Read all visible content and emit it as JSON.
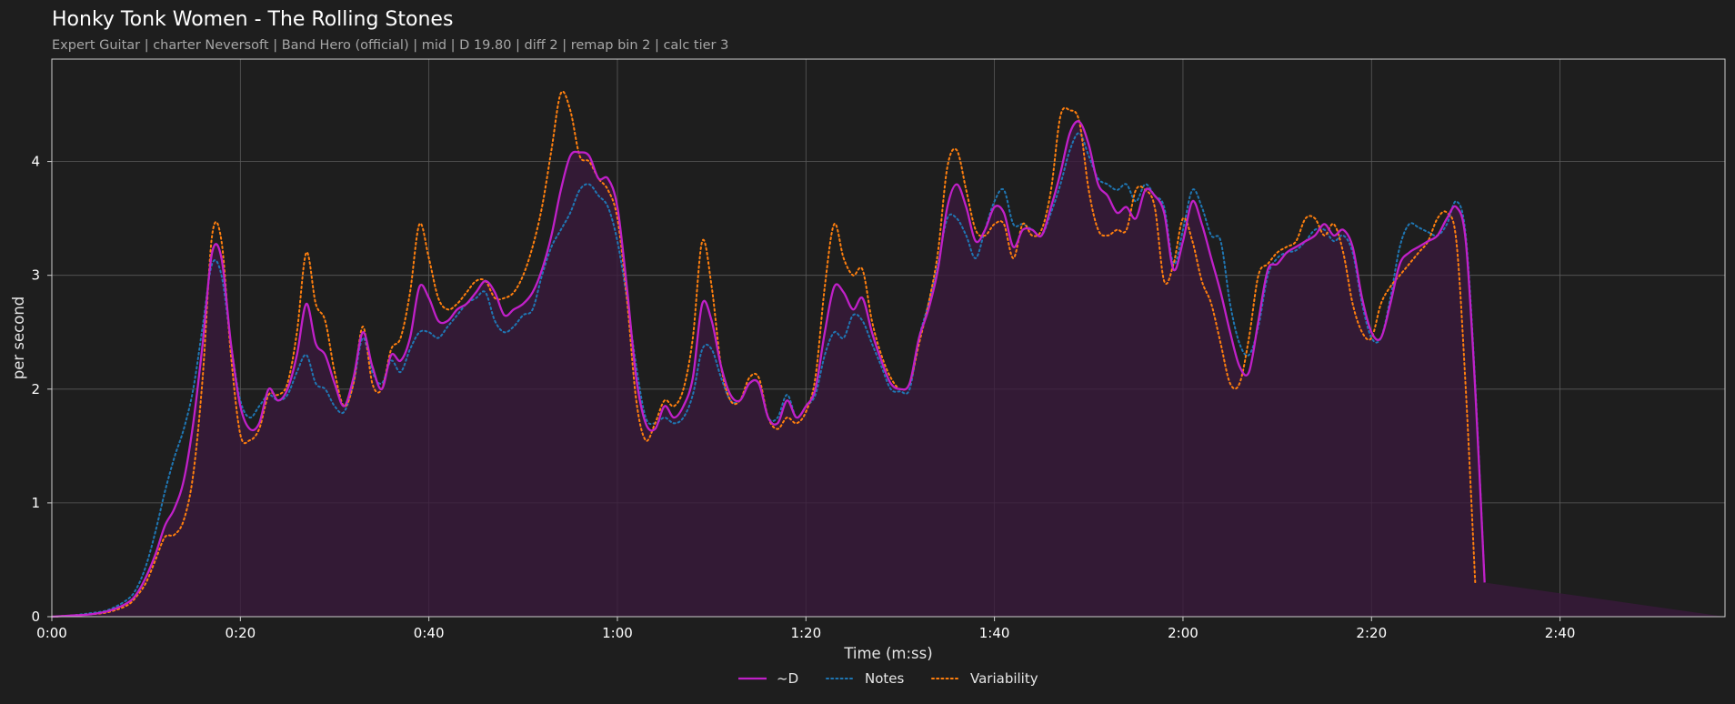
{
  "chart_data": {
    "type": "line",
    "title": "Honky Tonk Women - The Rolling Stones",
    "subtitle": "Expert Guitar  |  charter Neversoft  |  Band Hero (official)  |  mid  |  D 19.80  |  diff 2  |  remap bin 2  |  calc tier 3",
    "xlabel": "Time (m:ss)",
    "ylabel": "per second",
    "xlim": [
      0,
      177.5
    ],
    "ylim": [
      0,
      4.9
    ],
    "x_ticks": [
      0,
      20,
      40,
      60,
      80,
      100,
      120,
      140,
      160
    ],
    "x_tick_labels": [
      "0:00",
      "0:20",
      "0:40",
      "1:00",
      "1:20",
      "1:40",
      "2:00",
      "2:20",
      "2:40"
    ],
    "y_ticks": [
      0,
      1,
      2,
      3,
      4
    ],
    "y_tick_labels": [
      "0",
      "1",
      "2",
      "3",
      "4"
    ],
    "grid": true,
    "legend_position": "bottom-center",
    "x": [
      0,
      2,
      4,
      6,
      8,
      9,
      10,
      11,
      12,
      13,
      14,
      15,
      16,
      17,
      18,
      19,
      20,
      21,
      22,
      23,
      24,
      25,
      26,
      27,
      28,
      29,
      30,
      31,
      32,
      33,
      34,
      35,
      36,
      37,
      38,
      39,
      40,
      41,
      42,
      43,
      44,
      45,
      46,
      47,
      48,
      49,
      50,
      51,
      52,
      53,
      54,
      55,
      56,
      57,
      58,
      59,
      60,
      61,
      62,
      63,
      64,
      65,
      66,
      67,
      68,
      69,
      70,
      71,
      72,
      73,
      74,
      75,
      76,
      77,
      78,
      79,
      80,
      81,
      82,
      83,
      84,
      85,
      86,
      87,
      88,
      89,
      90,
      91,
      92,
      93,
      94,
      95,
      96,
      97,
      98,
      99,
      100,
      101,
      102,
      103,
      104,
      105,
      106,
      107,
      108,
      109,
      110,
      111,
      112,
      113,
      114,
      115,
      116,
      117,
      118,
      119,
      120,
      121,
      122,
      123,
      124,
      125,
      126,
      127,
      128,
      129,
      130,
      131,
      132,
      133,
      134,
      135,
      136,
      137,
      138,
      139,
      140,
      141,
      142,
      143,
      144,
      145,
      146,
      147,
      148,
      149,
      150,
      151,
      152,
      153,
      154,
      155,
      156,
      157,
      158,
      159,
      160,
      161,
      162,
      163,
      164,
      165,
      166,
      167,
      168,
      169,
      170,
      171,
      172,
      173,
      174,
      175,
      176,
      177.5
    ],
    "series": [
      {
        "name": "~D",
        "color": "#c020c8",
        "style": "solid",
        "values": [
          0,
          0.01,
          0.02,
          0.05,
          0.12,
          0.2,
          0.35,
          0.55,
          0.8,
          0.95,
          1.2,
          1.7,
          2.4,
          3.2,
          3.15,
          2.4,
          1.85,
          1.65,
          1.7,
          2,
          1.9,
          2,
          2.3,
          2.75,
          2.4,
          2.3,
          2.05,
          1.85,
          2.1,
          2.5,
          2.2,
          2,
          2.3,
          2.25,
          2.45,
          2.9,
          2.8,
          2.6,
          2.6,
          2.7,
          2.75,
          2.85,
          2.95,
          2.85,
          2.65,
          2.7,
          2.75,
          2.85,
          3.05,
          3.35,
          3.75,
          4.05,
          4.08,
          4.05,
          3.85,
          3.85,
          3.6,
          2.9,
          2.1,
          1.7,
          1.65,
          1.85,
          1.75,
          1.85,
          2.1,
          2.75,
          2.6,
          2.2,
          1.95,
          1.9,
          2.05,
          2.05,
          1.75,
          1.7,
          1.9,
          1.75,
          1.85,
          2,
          2.5,
          2.9,
          2.85,
          2.7,
          2.8,
          2.5,
          2.25,
          2.05,
          2,
          2.05,
          2.45,
          2.7,
          3.05,
          3.6,
          3.8,
          3.6,
          3.3,
          3.4,
          3.6,
          3.55,
          3.25,
          3.4,
          3.4,
          3.35,
          3.6,
          3.9,
          4.25,
          4.35,
          4.15,
          3.8,
          3.7,
          3.55,
          3.6,
          3.5,
          3.75,
          3.7,
          3.55,
          3.05,
          3.3,
          3.65,
          3.45,
          3.15,
          2.85,
          2.5,
          2.2,
          2.15,
          2.6,
          3.05,
          3.1,
          3.2,
          3.25,
          3.3,
          3.35,
          3.45,
          3.35,
          3.4,
          3.25,
          2.8,
          2.5,
          2.45,
          2.75,
          3.1,
          3.2,
          3.25,
          3.3,
          3.35,
          3.5,
          3.6,
          3.3,
          2.0,
          0.3
        ]
      },
      {
        "name": "Notes",
        "color": "#1f77b4",
        "style": "dotted",
        "values": [
          0,
          0.01,
          0.03,
          0.06,
          0.15,
          0.25,
          0.45,
          0.75,
          1.1,
          1.4,
          1.65,
          2,
          2.55,
          3.1,
          3,
          2.4,
          1.9,
          1.75,
          1.85,
          1.95,
          1.9,
          1.95,
          2.15,
          2.3,
          2.05,
          2,
          1.85,
          1.8,
          2.05,
          2.45,
          2.15,
          2.05,
          2.25,
          2.15,
          2.35,
          2.5,
          2.5,
          2.45,
          2.55,
          2.65,
          2.75,
          2.8,
          2.85,
          2.6,
          2.5,
          2.55,
          2.65,
          2.7,
          3,
          3.25,
          3.4,
          3.55,
          3.75,
          3.8,
          3.7,
          3.6,
          3.3,
          2.8,
          2.2,
          1.75,
          1.7,
          1.75,
          1.7,
          1.75,
          1.95,
          2.35,
          2.35,
          2.1,
          1.9,
          1.9,
          2.05,
          2.05,
          1.75,
          1.75,
          1.95,
          1.75,
          1.85,
          1.95,
          2.3,
          2.5,
          2.45,
          2.65,
          2.6,
          2.4,
          2.2,
          2,
          1.98,
          2,
          2.45,
          2.75,
          3.1,
          3.5,
          3.5,
          3.35,
          3.15,
          3.4,
          3.65,
          3.75,
          3.45,
          3.45,
          3.4,
          3.35,
          3.55,
          3.8,
          4.1,
          4.25,
          4.05,
          3.85,
          3.8,
          3.75,
          3.8,
          3.65,
          3.8,
          3.7,
          3.6,
          3.1,
          3.4,
          3.75,
          3.6,
          3.35,
          3.3,
          2.75,
          2.4,
          2.3,
          2.55,
          3,
          3.15,
          3.2,
          3.22,
          3.3,
          3.4,
          3.4,
          3.3,
          3.35,
          3.2,
          2.75,
          2.45,
          2.45,
          2.8,
          3.25,
          3.45,
          3.42,
          3.38,
          3.35,
          3.45,
          3.65,
          3.35,
          2.05,
          0.3
        ]
      },
      {
        "name": "Variability",
        "color": "#ff7f0e",
        "style": "dotted",
        "values": [
          0,
          0.01,
          0.02,
          0.04,
          0.1,
          0.18,
          0.3,
          0.5,
          0.7,
          0.72,
          0.85,
          1.25,
          2.1,
          3.35,
          3.3,
          2.3,
          1.6,
          1.55,
          1.65,
          1.95,
          1.95,
          2.05,
          2.5,
          3.2,
          2.75,
          2.6,
          2.15,
          1.85,
          2.05,
          2.55,
          2.05,
          2,
          2.35,
          2.45,
          2.85,
          3.45,
          3.15,
          2.8,
          2.7,
          2.75,
          2.85,
          2.95,
          2.95,
          2.8,
          2.8,
          2.85,
          3,
          3.25,
          3.6,
          4.1,
          4.6,
          4.45,
          4.05,
          4,
          3.85,
          3.75,
          3.5,
          2.8,
          1.9,
          1.55,
          1.7,
          1.9,
          1.85,
          2.0,
          2.45,
          3.3,
          2.9,
          2.2,
          1.9,
          1.9,
          2.1,
          2.1,
          1.75,
          1.65,
          1.75,
          1.7,
          1.8,
          2.1,
          2.9,
          3.45,
          3.15,
          3,
          3.05,
          2.6,
          2.3,
          2.1,
          2.0,
          2.05,
          2.4,
          2.75,
          3.2,
          3.95,
          4.1,
          3.75,
          3.4,
          3.35,
          3.45,
          3.45,
          3.15,
          3.45,
          3.35,
          3.4,
          3.75,
          4.4,
          4.45,
          4.35,
          3.75,
          3.4,
          3.35,
          3.4,
          3.4,
          3.75,
          3.75,
          3.6,
          2.95,
          3.1,
          3.5,
          3.3,
          2.95,
          2.75,
          2.4,
          2.05,
          2.05,
          2.45,
          3.0,
          3.1,
          3.2,
          3.25,
          3.3,
          3.5,
          3.5,
          3.35,
          3.45,
          3.2,
          2.75,
          2.5,
          2.45,
          2.75,
          2.9,
          3.0,
          3.1,
          3.2,
          3.3,
          3.5,
          3.55,
          3.3,
          2.0,
          0.3
        ]
      }
    ]
  }
}
